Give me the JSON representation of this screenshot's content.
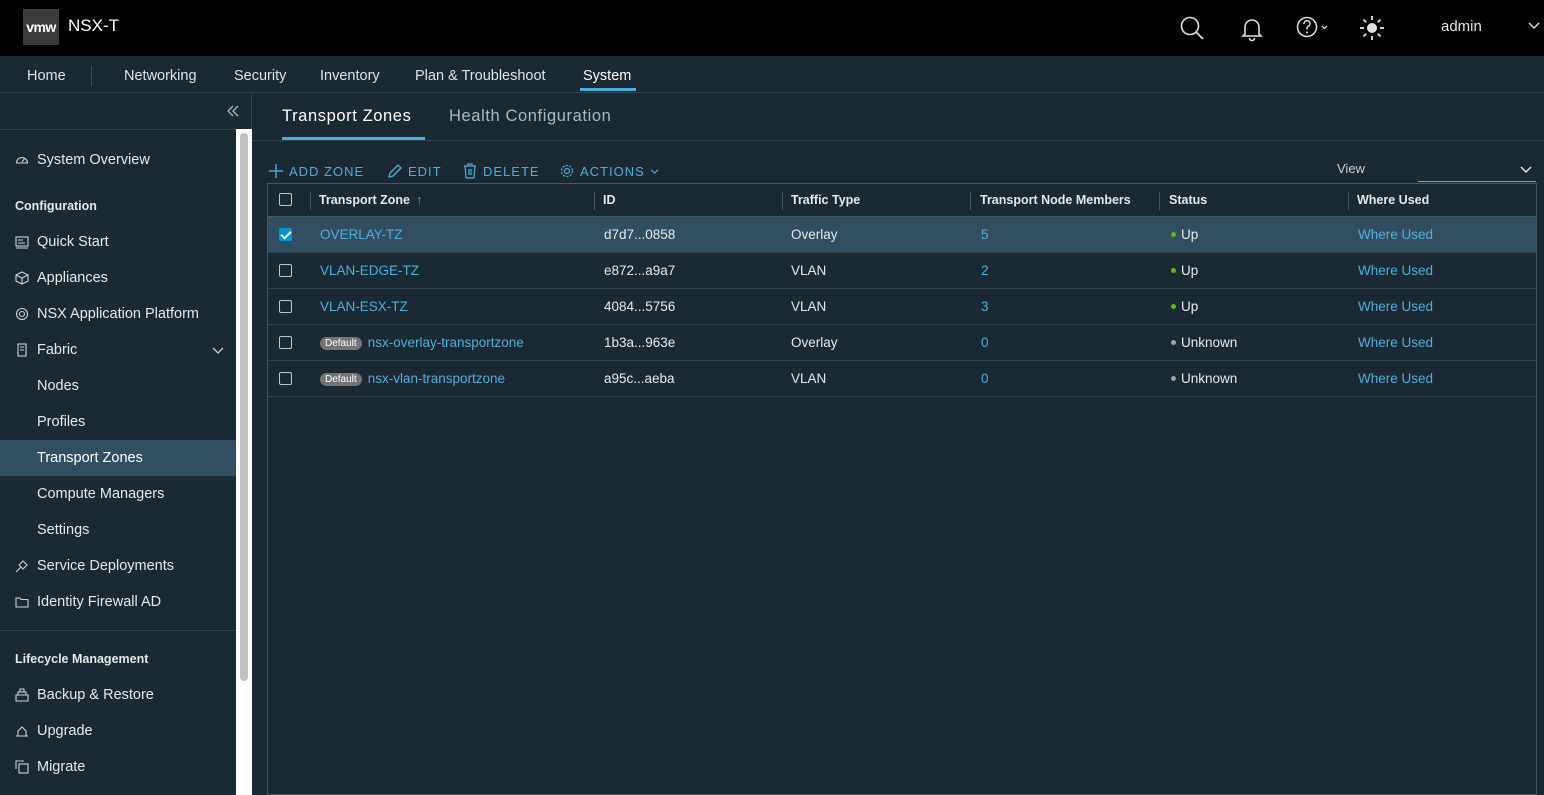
{
  "header": {
    "logo": "vmw",
    "product": "NSX-T",
    "user": "admin"
  },
  "mainnav": {
    "items": [
      "Home",
      "Networking",
      "Security",
      "Inventory",
      "Plan & Troubleshoot",
      "System"
    ],
    "active": "System"
  },
  "sidebar": {
    "system_overview": "System Overview",
    "config_heading": "Configuration",
    "quick_start": "Quick Start",
    "appliances": "Appliances",
    "nsx_app_platform": "NSX Application Platform",
    "fabric": "Fabric",
    "nodes": "Nodes",
    "profiles": "Profiles",
    "transport_zones": "Transport Zones",
    "compute_managers": "Compute Managers",
    "settings": "Settings",
    "service_deployments": "Service Deployments",
    "identity_firewall": "Identity Firewall AD",
    "lifecycle_heading": "Lifecycle Management",
    "backup_restore": "Backup & Restore",
    "upgrade": "Upgrade",
    "migrate": "Migrate"
  },
  "tabs": {
    "transport_zones": "Transport Zones",
    "health_config": "Health Configuration"
  },
  "toolbar": {
    "add_zone": "ADD ZONE",
    "edit": "EDIT",
    "delete": "DELETE",
    "actions": "ACTIONS",
    "view_label": "View"
  },
  "grid": {
    "columns": [
      "Transport Zone",
      "ID",
      "Traffic Type",
      "Transport Node Members",
      "Status",
      "Where Used"
    ],
    "sort_indicator": "↑",
    "default_badge": "Default",
    "rows": [
      {
        "name": "OVERLAY-TZ",
        "id": "d7d7...0858",
        "traffic": "Overlay",
        "members": "5",
        "status": "Up",
        "where": "Where Used"
      },
      {
        "name": "VLAN-EDGE-TZ",
        "id": "e872...a9a7",
        "traffic": "VLAN",
        "members": "2",
        "status": "Up",
        "where": "Where Used"
      },
      {
        "name": "VLAN-ESX-TZ",
        "id": "4084...5756",
        "traffic": "VLAN",
        "members": "3",
        "status": "Up",
        "where": "Where Used"
      },
      {
        "name": "nsx-overlay-transportzone",
        "id": "1b3a...963e",
        "traffic": "Overlay",
        "members": "0",
        "status": "Unknown",
        "where": "Where Used"
      },
      {
        "name": "nsx-vlan-transportzone",
        "id": "a95c...aeba",
        "traffic": "VLAN",
        "members": "0",
        "status": "Unknown",
        "where": "Where Used"
      }
    ]
  },
  "colors": {
    "accent": "#49afd9",
    "status_up": "#60b515",
    "status_unknown": "#9aa5ab",
    "selected_row": "#324f61"
  }
}
